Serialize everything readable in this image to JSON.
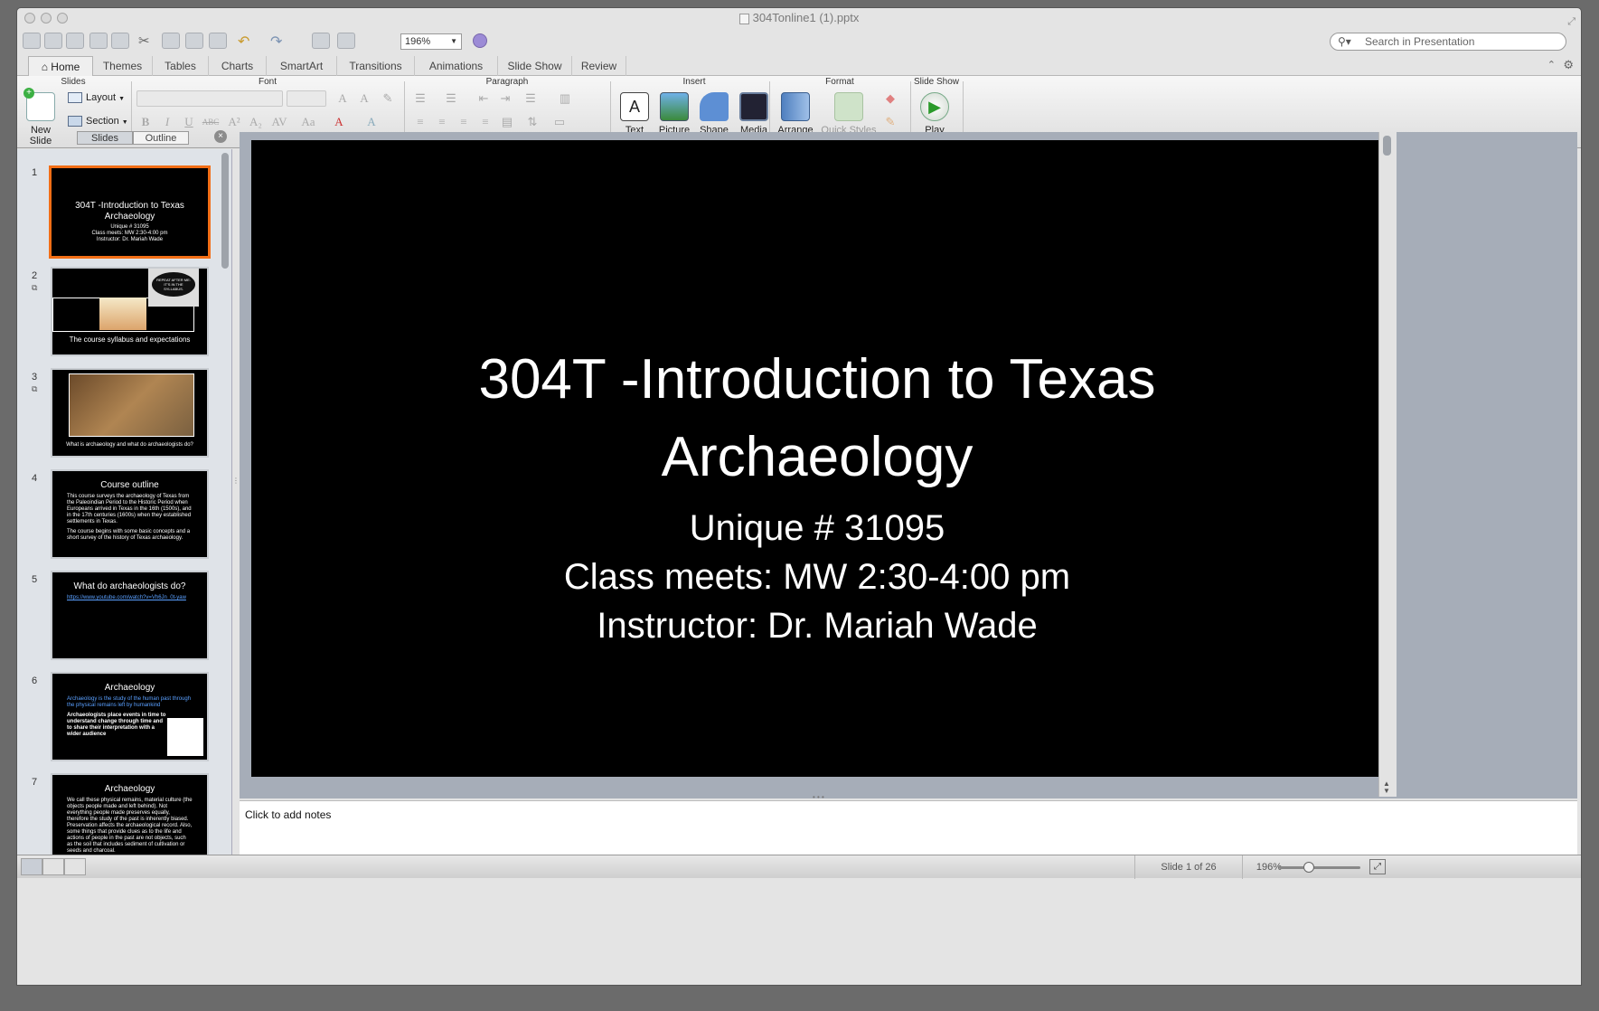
{
  "window": {
    "title": "304Tonline1 (1).pptx"
  },
  "toolbar": {
    "zoom": "196%",
    "search_placeholder": "Search in Presentation"
  },
  "ribbon_tabs": [
    "Home",
    "Themes",
    "Tables",
    "Charts",
    "SmartArt",
    "Transitions",
    "Animations",
    "Slide Show",
    "Review"
  ],
  "ribbon": {
    "groups": {
      "slides": "Slides",
      "font": "Font",
      "paragraph": "Paragraph",
      "insert": "Insert",
      "format": "Format",
      "slideshow": "Slide Show"
    },
    "new_slide": "New Slide",
    "layout": "Layout",
    "section": "Section",
    "insert_items": [
      "Text",
      "Picture",
      "Shape",
      "Media"
    ],
    "arrange": "Arrange",
    "quick_styles": "Quick Styles",
    "play": "Play"
  },
  "left_pane": {
    "tabs": [
      "Slides",
      "Outline"
    ]
  },
  "thumbnails": [
    {
      "num": "1",
      "title": "304T -Introduction to Texas Archaeology",
      "lines": [
        "Unique # 31095",
        "Class meets: MW 2:30-4:00 pm",
        "Instructor: Dr. Mariah Wade"
      ]
    },
    {
      "num": "2",
      "title": "The course syllabus and expectations",
      "bubble": "REPEAT AFTER ME: IT'S IN THE SYLLABUS."
    },
    {
      "num": "3",
      "title": "What is archaeology and what do archaeologists do?"
    },
    {
      "num": "4",
      "title": "Course outline",
      "bullets": [
        "This course surveys the archaeology of Texas from the Paleoindian Period to the Historic Period when Europeans arrived in Texas in the 16th (1500s), and in the 17th centuries (1600s) when they established settlements in Texas.",
        "The course begins with some basic concepts and a short survey of the history of Texas archaeology."
      ]
    },
    {
      "num": "5",
      "title": "What do archaeologists do?",
      "bullets": [
        "https://www.youtube.com/watch?v=Vh6Jn_0t-yaw"
      ]
    },
    {
      "num": "6",
      "title": "Archaeology",
      "bullets": [
        "Archaeology is the study of the human past through the physical remains left by humankind",
        "Archaeologists place events in time to understand change through time and to share their interpretation with a wider audience"
      ]
    },
    {
      "num": "7",
      "title": "Archaeology",
      "bullets": [
        "We call these physical remains, material culture (the objects people made and left behind). Not everything people made preserves equally, therefore the study of the past is inherently biased. Preservation affects the archaeological record. Also, some things that provide clues as to the life and actions of people in the past are not objects, such as the soil that includes sediment of cultivation or seeds and charcoal."
      ]
    }
  ],
  "slide": {
    "title": "304T -Introduction to Texas Archaeology",
    "unique": "Unique # 31095",
    "meets": "Class meets: MW 2:30-4:00 pm",
    "instructor": "Instructor: Dr. Mariah Wade"
  },
  "notes": {
    "placeholder": "Click to add notes"
  },
  "status": {
    "slide_info": "Slide 1 of 26",
    "zoom": "196%",
    "zoom_level_fraction": 0.35
  },
  "colors": {
    "selection": "#f26e16",
    "slide_bg": "#000000",
    "link": "#5aa0ff"
  }
}
